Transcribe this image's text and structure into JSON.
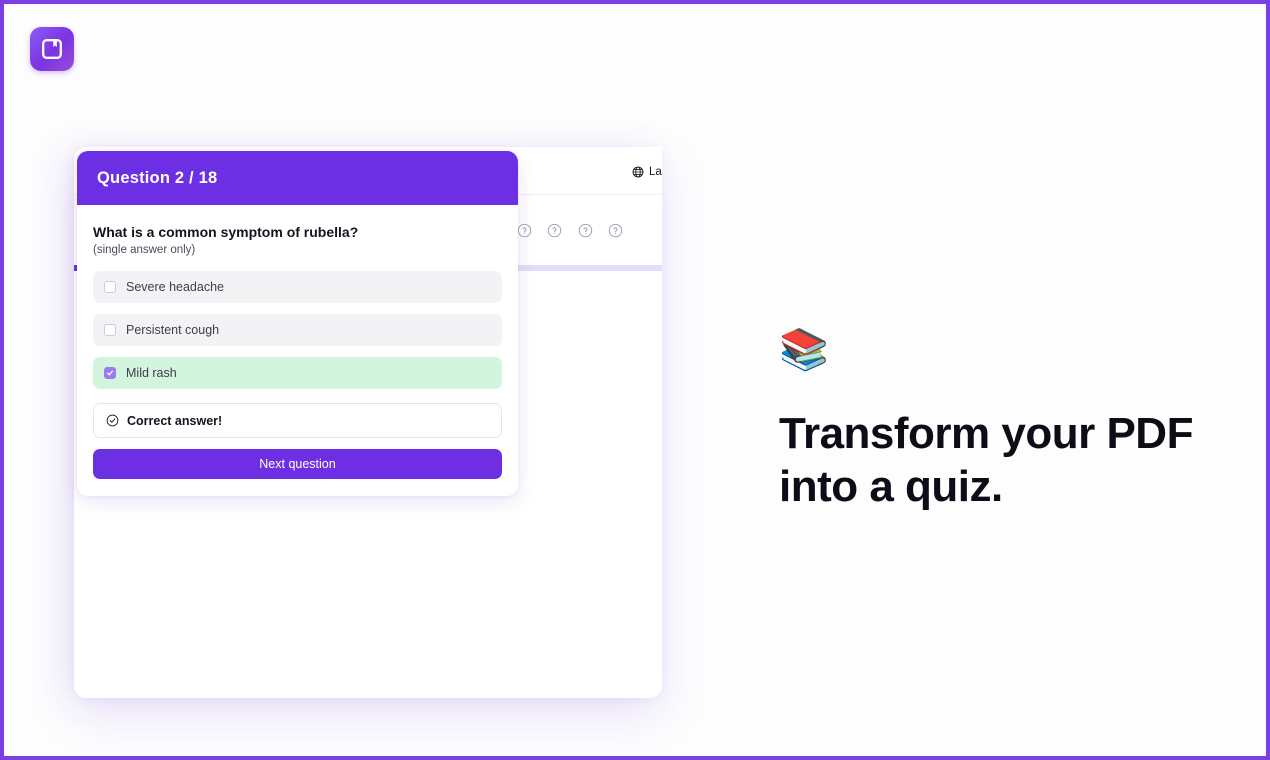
{
  "brand": {
    "logo_icon": "book-bookmark-icon",
    "accent_color": "#6d2fe3",
    "frame_color": "#7b3fe4"
  },
  "mockup": {
    "header": {
      "language_icon": "globe-icon",
      "language_label": "Lan"
    },
    "progress": {
      "current_question": 2,
      "total_questions": 18,
      "percent": 4,
      "fill_color": "#6d2fe3",
      "track_color": "#e4dcfb",
      "dots": [
        {
          "state": "incorrect",
          "icon": "circle-x-icon"
        },
        {
          "state": "current-correct",
          "icon": "circle-check-icon"
        },
        {
          "state": "pending",
          "icon": "circle-question-icon"
        },
        {
          "state": "pending",
          "icon": "circle-question-icon"
        },
        {
          "state": "pending",
          "icon": "circle-question-icon"
        },
        {
          "state": "pending",
          "icon": "circle-question-icon"
        },
        {
          "state": "pending",
          "icon": "circle-question-icon"
        },
        {
          "state": "pending",
          "icon": "circle-question-icon"
        },
        {
          "state": "pending",
          "icon": "circle-question-icon"
        },
        {
          "state": "pending",
          "icon": "circle-question-icon"
        },
        {
          "state": "pending",
          "icon": "circle-question-icon"
        },
        {
          "state": "pending",
          "icon": "circle-question-icon"
        },
        {
          "state": "pending",
          "icon": "circle-question-icon"
        },
        {
          "state": "pending",
          "icon": "circle-question-icon"
        },
        {
          "state": "pending",
          "icon": "circle-question-icon"
        },
        {
          "state": "pending",
          "icon": "circle-question-icon"
        },
        {
          "state": "pending",
          "icon": "circle-question-icon"
        },
        {
          "state": "pending",
          "icon": "circle-question-icon"
        }
      ]
    }
  },
  "quiz_card": {
    "header_title": "Question 2 / 18",
    "question": "What is a common symptom of rubella?",
    "question_hint": "(single answer only)",
    "options": [
      {
        "label": "Severe headache",
        "checked": false,
        "correct": false
      },
      {
        "label": "Persistent cough",
        "checked": false,
        "correct": false
      },
      {
        "label": "Mild rash",
        "checked": true,
        "correct": true
      }
    ],
    "feedback": {
      "icon": "circle-check-icon",
      "text": "Correct answer!"
    },
    "next_button_label": "Next question"
  },
  "hero": {
    "emoji": "📚",
    "heading_line_1": "Transform your PDF",
    "heading_line_2": "into a quiz."
  }
}
